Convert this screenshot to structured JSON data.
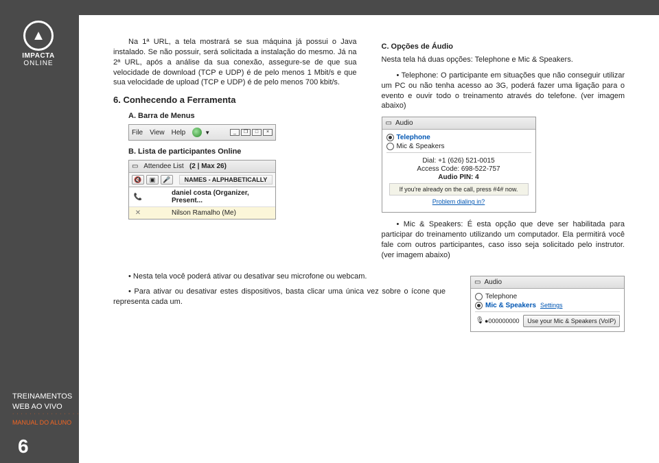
{
  "brand": {
    "name": "IMPACTA",
    "sub": "ONLINE"
  },
  "sidebar": {
    "line1": "TREINAMENTOS",
    "line2": "WEB AO VIVO",
    "manual": "MANUAL DO ALUNO",
    "page": "6"
  },
  "col1": {
    "p1": "Na 1ª URL, a tela mostrará se sua máquina já possui o Java instalado. Se não possuir, será solicitada a instalação do mesmo. Já na 2ª URL, após a análise da sua conexão, assegure-se de que sua velocidade de download (TCP e UDP) é de pelo menos 1 Mbit/s e que sua velocidade de upload (TCP e UDP) é de pelo menos 700 kbit/s.",
    "h6": "6. Conhecendo a Ferramenta",
    "a": "A. Barra de Menus",
    "b": "B. Lista de participantes Online"
  },
  "menubar": {
    "file": "File",
    "view": "View",
    "help": "Help"
  },
  "attendee": {
    "title_prefix": "Attendee List",
    "title_count": "(2 | Max 26)",
    "header": "NAMES - ALPHABETICALLY",
    "row1": "daniel costa (Organizer, Present...",
    "row2": "Nilson Ramalho (Me)"
  },
  "col2": {
    "c": "C. Opções de Áudio",
    "p1": "Nesta tela há duas opções: Telephone e Mic & Speakers.",
    "bullet1": "• Telephone: O participante em situações que não conseguir utilizar um PC ou não tenha acesso ao 3G, poderá fazer uma ligação para o evento e ouvir todo o treinamento através do telefone. (ver imagem abaixo)",
    "bullet2": "• Mic & Speakers: É esta opção que deve ser habilitada  para participar do treinamento utilizando um computador. Ela permitirá você fale com outros participantes, caso isso seja solicitado pelo instrutor. (ver imagem abaixo)"
  },
  "audio1": {
    "title": "Audio",
    "opt1": "Telephone",
    "opt2": "Mic & Speakers",
    "dial": "Dial: +1 (626) 521-0015",
    "access": "Access Code: 698-522-757",
    "pin": "Audio PIN: 4",
    "note": "If you're already on the call, press #4# now.",
    "link": "Problem dialing in?"
  },
  "audio2": {
    "title": "Audio",
    "opt1": "Telephone",
    "opt2": "Mic & Speakers",
    "settings": "Settings",
    "meter": "●000000000",
    "btn": "Use your Mic & Speakers (VoIP)"
  },
  "bottom": {
    "p1": "• Nesta tela você poderá ativar ou desativar seu microfone ou webcam.",
    "p2": "• Para ativar ou desativar estes dispositivos, basta clicar uma única vez sobre o ícone que representa cada um."
  }
}
